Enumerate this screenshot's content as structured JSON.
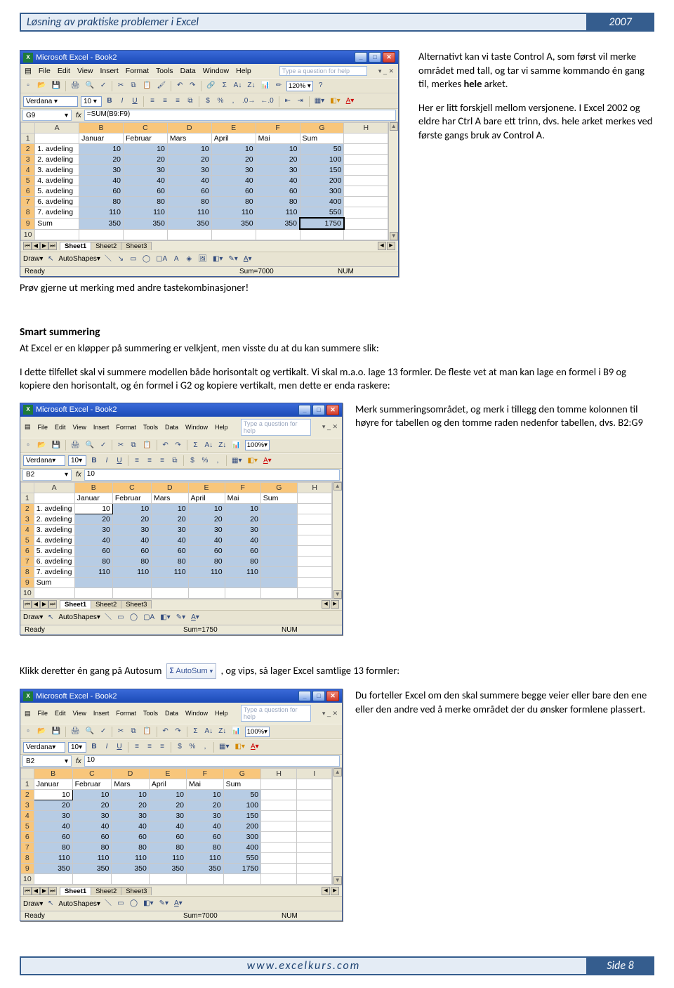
{
  "header": {
    "title": "Løsning av praktiske problemer i Excel",
    "year": "2007"
  },
  "footer": {
    "url": "www.excelkurs.com",
    "page": "Side 8"
  },
  "block1": {
    "win_title": "Microsoft Excel - Book2",
    "menu": [
      "File",
      "Edit",
      "View",
      "Insert",
      "Format",
      "Tools",
      "Data",
      "Window",
      "Help"
    ],
    "help_placeholder": "Type a question for help",
    "font": "Verdana",
    "font_size": "10",
    "namebox": "G9",
    "formula": "=SUM(B9:F9)",
    "zoom": "120%",
    "cols": [
      "",
      "A",
      "B",
      "C",
      "D",
      "E",
      "F",
      "G",
      "H"
    ],
    "rows": [
      {
        "r": "1",
        "a": "",
        "b": "Januar",
        "c": "Februar",
        "d": "Mars",
        "e": "April",
        "f": "Mai",
        "g": "Sum",
        "h": ""
      },
      {
        "r": "2",
        "a": "1. avdeling",
        "b": "10",
        "c": "10",
        "d": "10",
        "e": "10",
        "f": "10",
        "g": "50",
        "h": ""
      },
      {
        "r": "3",
        "a": "2. avdeling",
        "b": "20",
        "c": "20",
        "d": "20",
        "e": "20",
        "f": "20",
        "g": "100",
        "h": ""
      },
      {
        "r": "4",
        "a": "3. avdeling",
        "b": "30",
        "c": "30",
        "d": "30",
        "e": "30",
        "f": "30",
        "g": "150",
        "h": ""
      },
      {
        "r": "5",
        "a": "4. avdeling",
        "b": "40",
        "c": "40",
        "d": "40",
        "e": "40",
        "f": "40",
        "g": "200",
        "h": ""
      },
      {
        "r": "6",
        "a": "5. avdeling",
        "b": "60",
        "c": "60",
        "d": "60",
        "e": "60",
        "f": "60",
        "g": "300",
        "h": ""
      },
      {
        "r": "7",
        "a": "6. avdeling",
        "b": "80",
        "c": "80",
        "d": "80",
        "e": "80",
        "f": "80",
        "g": "400",
        "h": ""
      },
      {
        "r": "8",
        "a": "7. avdeling",
        "b": "110",
        "c": "110",
        "d": "110",
        "e": "110",
        "f": "110",
        "g": "550",
        "h": ""
      },
      {
        "r": "9",
        "a": "Sum",
        "b": "350",
        "c": "350",
        "d": "350",
        "e": "350",
        "f": "350",
        "g": "1750",
        "h": ""
      },
      {
        "r": "10",
        "a": "",
        "b": "",
        "c": "",
        "d": "",
        "e": "",
        "f": "",
        "g": "",
        "h": ""
      }
    ],
    "tabs": [
      "Sheet1",
      "Sheet2",
      "Sheet3"
    ],
    "draw_label": "Draw",
    "autoshapes_label": "AutoShapes",
    "status_ready": "Ready",
    "status_sum": "Sum=7000",
    "status_num": "NUM",
    "caption": "Prøv gjerne ut merking med andre tastekombinasjoner!",
    "side_p1a": "Alternativt kan vi taste Control A, som først vil merke området med tall, og tar vi samme kommando én gang til, merkes ",
    "side_p1b": "hele",
    "side_p1c": " arket.",
    "side_p2": "Her er litt forskjell mellom versjonene. I Excel 2002 og eldre har Ctrl A bare ett trinn, dvs. hele arket merkes ved første gangs bruk av Control A."
  },
  "smart": {
    "heading": "Smart summering",
    "p1": "At Excel er en kløpper på summering er velkjent, men visste du at du kan summere slik:",
    "p2": "I dette tilfellet skal vi summere modellen både horisontalt og vertikalt. Vi skal m.a.o. lage 13 formler. De fleste vet at man kan lage en formel i B9 og kopiere den horisontalt, og én formel i G2 og kopiere vertikalt, men dette er enda raskere:",
    "side": "Merk summeringsområdet, og merk i tillegg den tomme kolonnen til høyre for tabellen og den tomme raden nedenfor tabellen, dvs. B2:G9"
  },
  "block2": {
    "win_title": "Microsoft Excel - Book2",
    "help_placeholder": "Type a question for help",
    "font": "Verdana",
    "font_size": "10",
    "namebox": "B2",
    "nb_value": "10",
    "zoom": "100%",
    "cols": [
      "",
      "A",
      "B",
      "C",
      "D",
      "E",
      "F",
      "G",
      "H"
    ],
    "rows": [
      {
        "r": "1",
        "a": "",
        "b": "Januar",
        "c": "Februar",
        "d": "Mars",
        "e": "April",
        "f": "Mai",
        "g": "Sum",
        "h": ""
      },
      {
        "r": "2",
        "a": "1. avdeling",
        "b": "10",
        "c": "10",
        "d": "10",
        "e": "10",
        "f": "10",
        "g": "",
        "h": ""
      },
      {
        "r": "3",
        "a": "2. avdeling",
        "b": "20",
        "c": "20",
        "d": "20",
        "e": "20",
        "f": "20",
        "g": "",
        "h": ""
      },
      {
        "r": "4",
        "a": "3. avdeling",
        "b": "30",
        "c": "30",
        "d": "30",
        "e": "30",
        "f": "30",
        "g": "",
        "h": ""
      },
      {
        "r": "5",
        "a": "4. avdeling",
        "b": "40",
        "c": "40",
        "d": "40",
        "e": "40",
        "f": "40",
        "g": "",
        "h": ""
      },
      {
        "r": "6",
        "a": "5. avdeling",
        "b": "60",
        "c": "60",
        "d": "60",
        "e": "60",
        "f": "60",
        "g": "",
        "h": ""
      },
      {
        "r": "7",
        "a": "6. avdeling",
        "b": "80",
        "c": "80",
        "d": "80",
        "e": "80",
        "f": "80",
        "g": "",
        "h": ""
      },
      {
        "r": "8",
        "a": "7. avdeling",
        "b": "110",
        "c": "110",
        "d": "110",
        "e": "110",
        "f": "110",
        "g": "",
        "h": ""
      },
      {
        "r": "9",
        "a": "Sum",
        "b": "",
        "c": "",
        "d": "",
        "e": "",
        "f": "",
        "g": "",
        "h": ""
      },
      {
        "r": "10",
        "a": "",
        "b": "",
        "c": "",
        "d": "",
        "e": "",
        "f": "",
        "g": "",
        "h": ""
      }
    ],
    "status_sum": "Sum=1750"
  },
  "autosum_line_a": "Klikk deretter én gang på Autosum ",
  "autosum_label": "AutoSum",
  "autosum_line_b": ", og vips, så lager Excel samtlige 13 formler:",
  "block3": {
    "win_title": "Microsoft Excel - Book2",
    "help_placeholder": "Type a question for help",
    "font": "Verdana",
    "font_size": "10",
    "namebox": "B2",
    "nb_value": "10",
    "zoom": "100%",
    "cols": [
      "",
      "B",
      "C",
      "D",
      "E",
      "F",
      "G",
      "H",
      "I"
    ],
    "rows": [
      {
        "r": "1",
        "a": "Januar",
        "b": "Februar",
        "c": "Mars",
        "d": "April",
        "e": "Mai",
        "f": "Sum",
        "g": "",
        "h": ""
      },
      {
        "r": "2",
        "a": "10",
        "b": "10",
        "c": "10",
        "d": "10",
        "e": "10",
        "f": "50",
        "g": "",
        "h": ""
      },
      {
        "r": "3",
        "a": "20",
        "b": "20",
        "c": "20",
        "d": "20",
        "e": "20",
        "f": "100",
        "g": "",
        "h": ""
      },
      {
        "r": "4",
        "a": "30",
        "b": "30",
        "c": "30",
        "d": "30",
        "e": "30",
        "f": "150",
        "g": "",
        "h": ""
      },
      {
        "r": "5",
        "a": "40",
        "b": "40",
        "c": "40",
        "d": "40",
        "e": "40",
        "f": "200",
        "g": "",
        "h": ""
      },
      {
        "r": "6",
        "a": "60",
        "b": "60",
        "c": "60",
        "d": "60",
        "e": "60",
        "f": "300",
        "g": "",
        "h": ""
      },
      {
        "r": "7",
        "a": "80",
        "b": "80",
        "c": "80",
        "d": "80",
        "e": "80",
        "f": "400",
        "g": "",
        "h": ""
      },
      {
        "r": "8",
        "a": "110",
        "b": "110",
        "c": "110",
        "d": "110",
        "e": "110",
        "f": "550",
        "g": "",
        "h": ""
      },
      {
        "r": "9",
        "a": "350",
        "b": "350",
        "c": "350",
        "d": "350",
        "e": "350",
        "f": "1750",
        "g": "",
        "h": ""
      },
      {
        "r": "10",
        "a": "",
        "b": "",
        "c": "",
        "d": "",
        "e": "",
        "f": "",
        "g": "",
        "h": ""
      }
    ],
    "status_sum": "Sum=7000",
    "side": "Du forteller Excel om den skal summere begge veier eller bare den ene eller den andre ved å merke området der du ønsker formlene plassert."
  }
}
